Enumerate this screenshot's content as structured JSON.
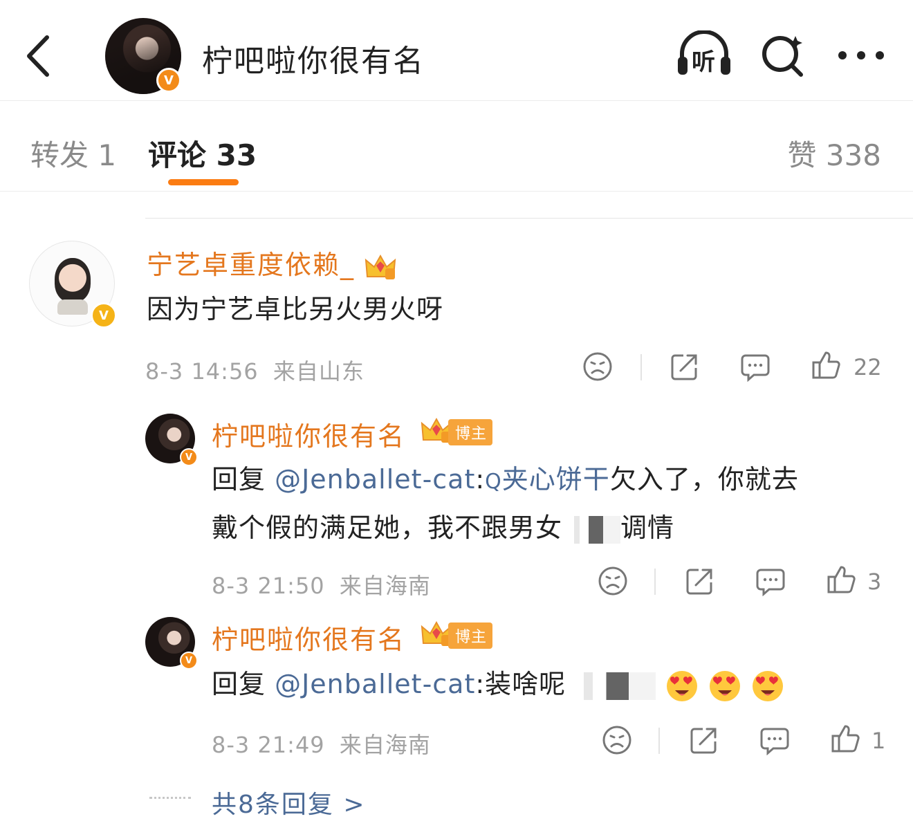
{
  "header": {
    "title": "柠吧啦你很有名",
    "listen_label": "听",
    "verified_mark": "V"
  },
  "tabs": {
    "forward": "转发 1",
    "comments": "评论 33",
    "likes": "赞 338"
  },
  "comments": [
    {
      "username": "宁艺卓重度依赖_",
      "crown_level": "3",
      "text": "因为宁艺卓比另火男火呀",
      "time": "8-3 14:56",
      "location": "来自山东",
      "likes": "22",
      "verified_mark": "V"
    }
  ],
  "replies": [
    {
      "username": "柠吧啦你很有名",
      "tag": "博主",
      "crown_level": "6",
      "reply_prefix": "回复 ",
      "mention": "@Jenballet-cat",
      "search_glyph": "Q",
      "link_text": "夹心饼干",
      "text_line1_rest": "欠入了，你就去",
      "text_line2": "戴个假的满足她，我不跟男女",
      "text_line2_end": "调情",
      "time": "8-3 21:50",
      "location": "来自海南",
      "likes": "3",
      "verified_mark": "V"
    },
    {
      "username": "柠吧啦你很有名",
      "tag": "博主",
      "crown_level": "6",
      "reply_prefix": "回复 ",
      "mention": "@Jenballet-cat",
      "text": ":装啥呢",
      "time": "8-3 21:49",
      "location": "来自海南",
      "likes": "1",
      "verified_mark": "V"
    }
  ],
  "more_replies": "共8条回复 >",
  "colors": {
    "accent": "#fb7c12",
    "username": "#e4771e",
    "mention": "#4b6a96",
    "meta": "#a3a3a3"
  },
  "icons": [
    "back-icon",
    "listen-icon",
    "search-icon",
    "more-icon",
    "dislike-icon",
    "share-icon",
    "comment-icon",
    "like-icon",
    "crown-icon",
    "heart-eyes-emoji"
  ]
}
